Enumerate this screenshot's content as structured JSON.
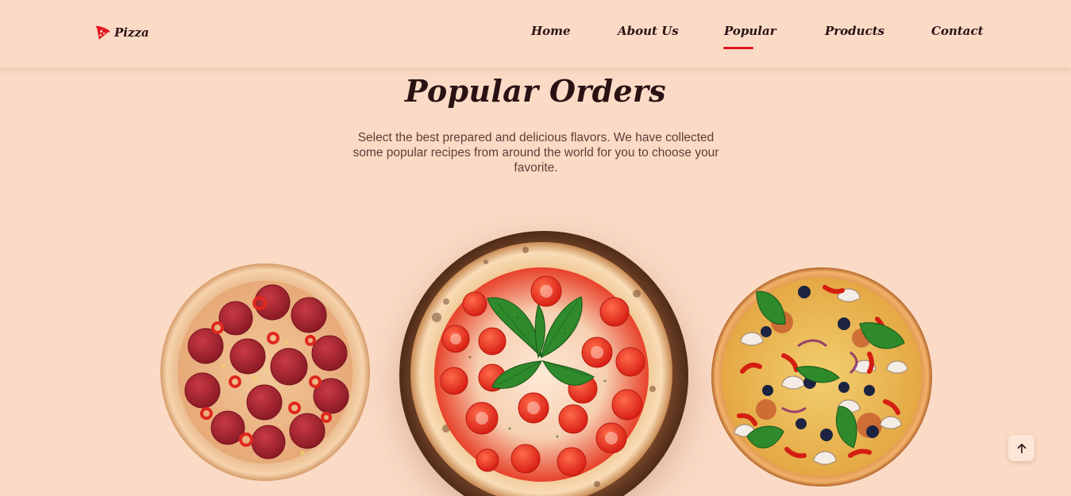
{
  "brand": {
    "name": "Pizza",
    "icon": "pizza-slice-icon",
    "accent": "#e0141e"
  },
  "nav": {
    "items": [
      {
        "label": "Home"
      },
      {
        "label": "About Us"
      },
      {
        "label": "Popular",
        "active": true
      },
      {
        "label": "Products"
      },
      {
        "label": "Contact"
      }
    ]
  },
  "hero": {
    "title": "Popular Orders",
    "subtitle": "Select the best prepared and delicious flavors. We have collected some popular recipes from around the world for you to choose your favorite."
  },
  "pizzas": [
    {
      "name": "pepperoni-pizza-image"
    },
    {
      "name": "margherita-pizza-image"
    },
    {
      "name": "supreme-pizza-image"
    }
  ],
  "back_to_top": {
    "icon": "arrow-up-icon"
  },
  "colors": {
    "background": "#fbdbc6",
    "text": "#2a1214",
    "accent": "#e0141e"
  }
}
